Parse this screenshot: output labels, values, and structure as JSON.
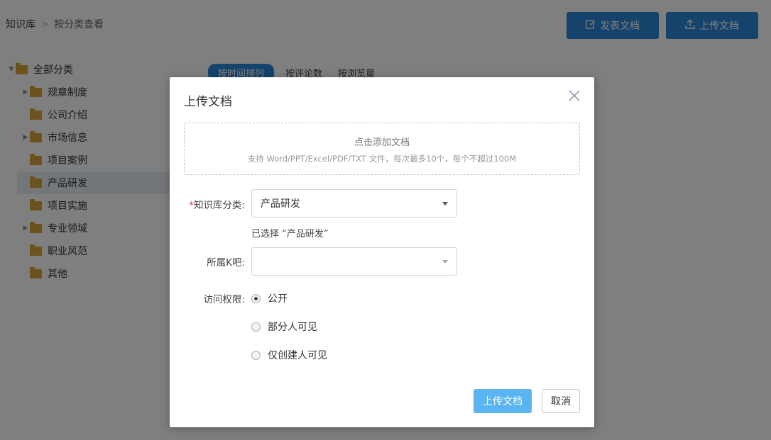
{
  "breadcrumb": {
    "root": "知识库",
    "separator": ">",
    "current": "按分类查看"
  },
  "toolbar": {
    "publish_label": "发表文档",
    "upload_label": "上传文档",
    "accent": "#2a87d8"
  },
  "tree": {
    "root": "全部分类",
    "items": [
      {
        "label": "规章制度",
        "expandable": true
      },
      {
        "label": "公司介绍",
        "expandable": false
      },
      {
        "label": "市场信息",
        "expandable": true
      },
      {
        "label": "项目案例",
        "expandable": false
      },
      {
        "label": "产品研发",
        "expandable": false,
        "selected": true
      },
      {
        "label": "项目实施",
        "expandable": false
      },
      {
        "label": "专业领域",
        "expandable": true
      },
      {
        "label": "职业风范",
        "expandable": false
      },
      {
        "label": "其他",
        "expandable": false
      }
    ]
  },
  "sort_tabs": {
    "active": "按时间排列",
    "comments": "按评论数",
    "views": "按浏览量"
  },
  "modal": {
    "title": "上传文档",
    "dropzone": {
      "main": "点击添加文档",
      "sub": "支持 Word/PPT/Excel/PDF/TXT 文件，每次最多10个，每个不超过100M"
    },
    "category": {
      "required_mark": "*",
      "label": "知识库分类:",
      "value": "产品研发",
      "hint": "已选择 “产品研发”"
    },
    "kba": {
      "label": "所属K吧:",
      "value": ""
    },
    "access": {
      "label": "访问权限:",
      "options": [
        {
          "label": "公开",
          "checked": true
        },
        {
          "label": "部分人可见",
          "checked": false
        },
        {
          "label": "仅创建人可见",
          "checked": false
        }
      ]
    },
    "submit_label": "上传文档",
    "cancel_label": "取消"
  }
}
